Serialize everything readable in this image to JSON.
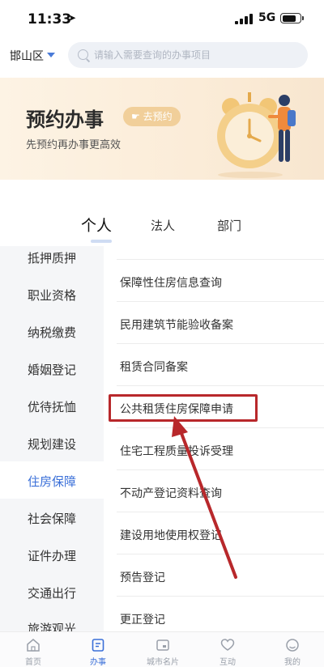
{
  "status_bar": {
    "time": "11:33",
    "network": "5G"
  },
  "search": {
    "district": "邯山区",
    "placeholder": "请输入需要查询的办事项目"
  },
  "banner": {
    "title": "预约办事",
    "button_label": "去预约",
    "subtitle": "先预约再办事更高效"
  },
  "tabs": [
    {
      "label": "个人"
    },
    {
      "label": "法人"
    },
    {
      "label": "部门"
    }
  ],
  "categories": [
    {
      "label": "抵押质押"
    },
    {
      "label": "职业资格"
    },
    {
      "label": "纳税缴费"
    },
    {
      "label": "婚姻登记"
    },
    {
      "label": "优待抚恤"
    },
    {
      "label": "规划建设"
    },
    {
      "label": "住房保障"
    },
    {
      "label": "社会保障"
    },
    {
      "label": "证件办理"
    },
    {
      "label": "交通出行"
    },
    {
      "label": "旅游观光"
    }
  ],
  "services": [
    {
      "label": "保障性住房信息查询"
    },
    {
      "label": "民用建筑节能验收备案"
    },
    {
      "label": "租赁合同备案"
    },
    {
      "label": "公共租赁住房保障申请"
    },
    {
      "label": "住宅工程质量投诉受理"
    },
    {
      "label": "不动产登记资料查询"
    },
    {
      "label": "建设用地使用权登记"
    },
    {
      "label": "预告登记"
    },
    {
      "label": "更正登记"
    }
  ],
  "bottom_nav": [
    {
      "label": "首页"
    },
    {
      "label": "办事"
    },
    {
      "label": "城市名片"
    },
    {
      "label": "互动"
    },
    {
      "label": "我的"
    }
  ],
  "colors": {
    "accent": "#3a6fd8",
    "highlight": "#b8282b",
    "banner_bg": "#fbecd8"
  }
}
